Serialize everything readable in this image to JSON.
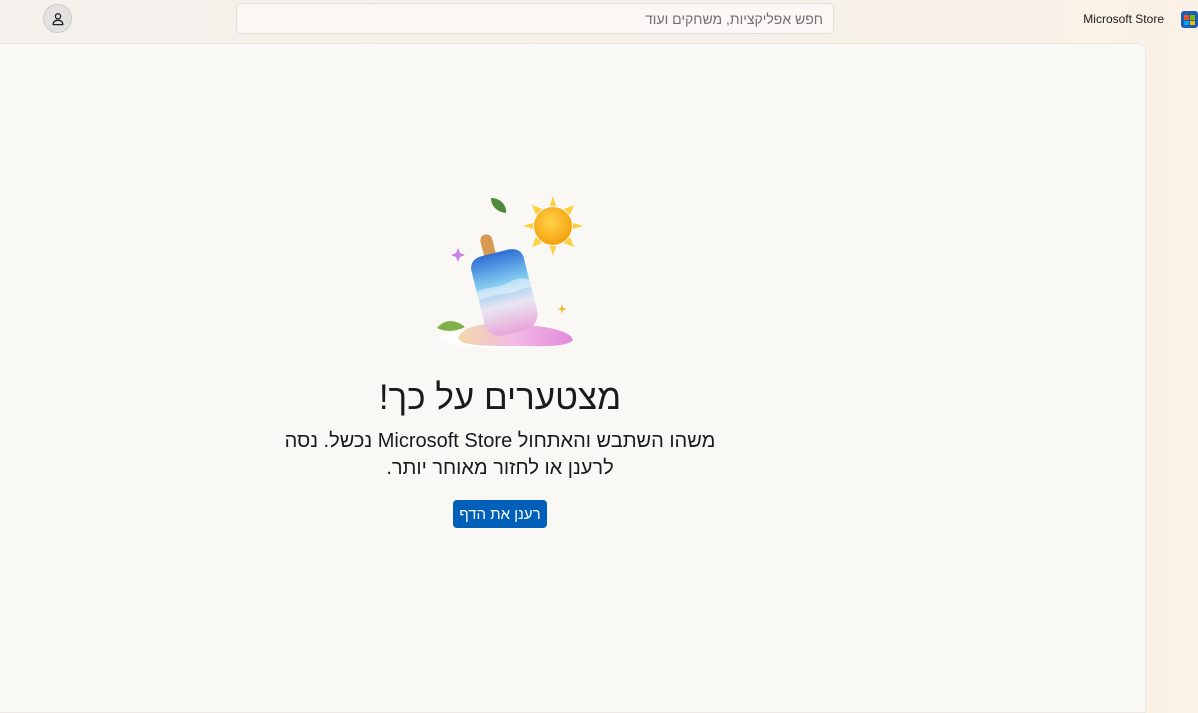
{
  "titlebar": {
    "app_title": "Microsoft Store",
    "app_icon": "microsoft-store-icon",
    "search_placeholder": "חפש אפליקציות, משחקים ועוד",
    "search_value": "",
    "account_icon": "person-icon"
  },
  "error_page": {
    "illustration": "melting-popsicle-sun-illustration",
    "heading": "מצטערים על כך!",
    "message": "משהו השתבש והאתחול Microsoft Store נכשל. נסה לרענן או לחזור מאוחר יותר.",
    "refresh_button": "רענן את הדף"
  },
  "colors": {
    "accent": "#005fb8",
    "background": "#faf8f5",
    "text": "#1a1a1a"
  }
}
